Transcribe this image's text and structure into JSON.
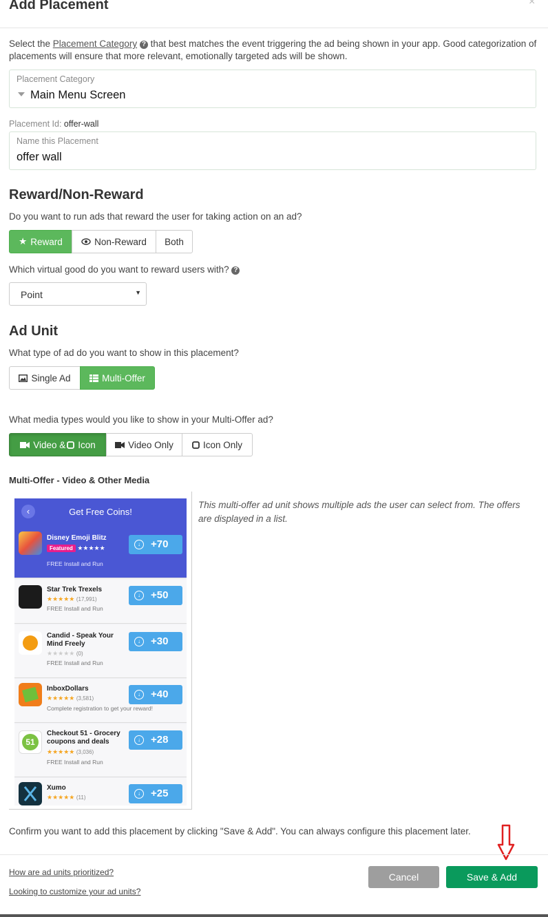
{
  "modal": {
    "title": "Add Placement",
    "close": "×"
  },
  "intro": {
    "before": "Select the ",
    "link": "Placement Category",
    "after": " that best matches the event triggering the ad being shown in your app. Good categorization of placements will ensure that more relevant, emotionally targeted ads will be shown."
  },
  "category_field": {
    "label": "Placement Category",
    "value": "Main Menu Screen"
  },
  "placement_id": {
    "label": "Placement Id:",
    "value": "offer-wall"
  },
  "name_field": {
    "label": "Name this Placement",
    "value": "offer wall"
  },
  "reward": {
    "heading": "Reward/Non-Reward",
    "question": "Do you want to run ads that reward the user for taking action on an ad?",
    "options": [
      "Reward",
      "Non-Reward",
      "Both"
    ],
    "selected": "Reward",
    "virtual_good_question": "Which virtual good do you want to reward users with?",
    "virtual_good_value": "Point"
  },
  "ad_unit": {
    "heading": "Ad Unit",
    "question": "What type of ad do you want to show in this placement?",
    "options": [
      "Single Ad",
      "Multi-Offer"
    ],
    "selected": "Multi-Offer",
    "media_question": "What media types would you like to show in your Multi-Offer ad?",
    "media_options": [
      "Video & ",
      "Icon",
      "Video Only",
      "Icon Only"
    ],
    "media_selected": "Video & Icon"
  },
  "preview": {
    "heading": "Multi-Offer - Video & Other Media",
    "header_title": "Get Free Coins!",
    "description": "This multi-offer ad unit shows multiple ads the user can select from. The offers are displayed in a list.",
    "offers": [
      {
        "name": "Disney Emoji Blitz",
        "badge": "Featured",
        "stars": "★★★★★",
        "count": "",
        "sub": "FREE Install and Run",
        "coins": "+70"
      },
      {
        "name": "Star Trek Trexels",
        "stars": "★★★★★",
        "count": "(17,991)",
        "sub": "FREE Install and Run",
        "coins": "+50"
      },
      {
        "name": "Candid - Speak Your Mind Freely",
        "stars": "★★★★★",
        "count": "(0)",
        "sub": "FREE Install and Run",
        "coins": "+30"
      },
      {
        "name": "InboxDollars",
        "stars": "★★★★★",
        "count": "(3,581)",
        "sub": "Complete registration to get your reward!",
        "coins": "+40"
      },
      {
        "name": "Checkout 51 - Grocery coupons and deals",
        "stars": "★★★★★",
        "count": "(3,036)",
        "sub": "FREE Install and Run",
        "coins": "+28"
      },
      {
        "name": "Xumo",
        "stars": "★★★★★",
        "count": "(11)",
        "sub": "",
        "coins": "+25"
      }
    ],
    "icon_text": {
      "checkout": "51"
    }
  },
  "confirm": "Confirm you want to add this placement by clicking \"Save & Add\". You can always configure this placement later.",
  "footer": {
    "link1": "How are ad units prioritized?",
    "link2": "Looking to customize your ad units?",
    "cancel": "Cancel",
    "save": "Save & Add"
  },
  "colors": {
    "green": "#5cb85c",
    "save": "#0a9a5c",
    "cancel": "#9e9e9e",
    "phone_header": "#4a57d4",
    "coin_button": "#4ba8ea",
    "arrow": "#e02020"
  }
}
